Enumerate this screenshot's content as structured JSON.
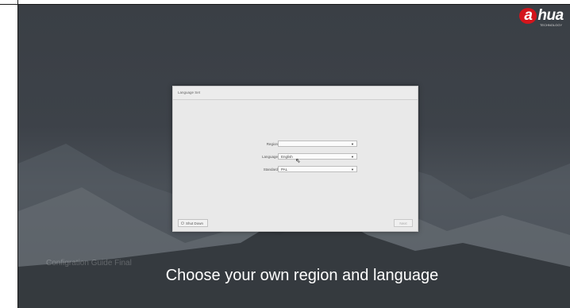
{
  "brand": {
    "logo_text": "hua",
    "logo_mark": "a",
    "tagline": "TECHNOLOGY",
    "accent": "#d4151c"
  },
  "dialog": {
    "title": "Language Set",
    "fields": [
      {
        "label": "Region",
        "value": ""
      },
      {
        "label": "Language",
        "value": "English"
      },
      {
        "label": "Standard",
        "value": "PAL"
      }
    ],
    "shutdown_label": "Shut Down",
    "next_label": "Next"
  },
  "watermark": "Configration Guide Final",
  "caption": "Choose your own region and language"
}
